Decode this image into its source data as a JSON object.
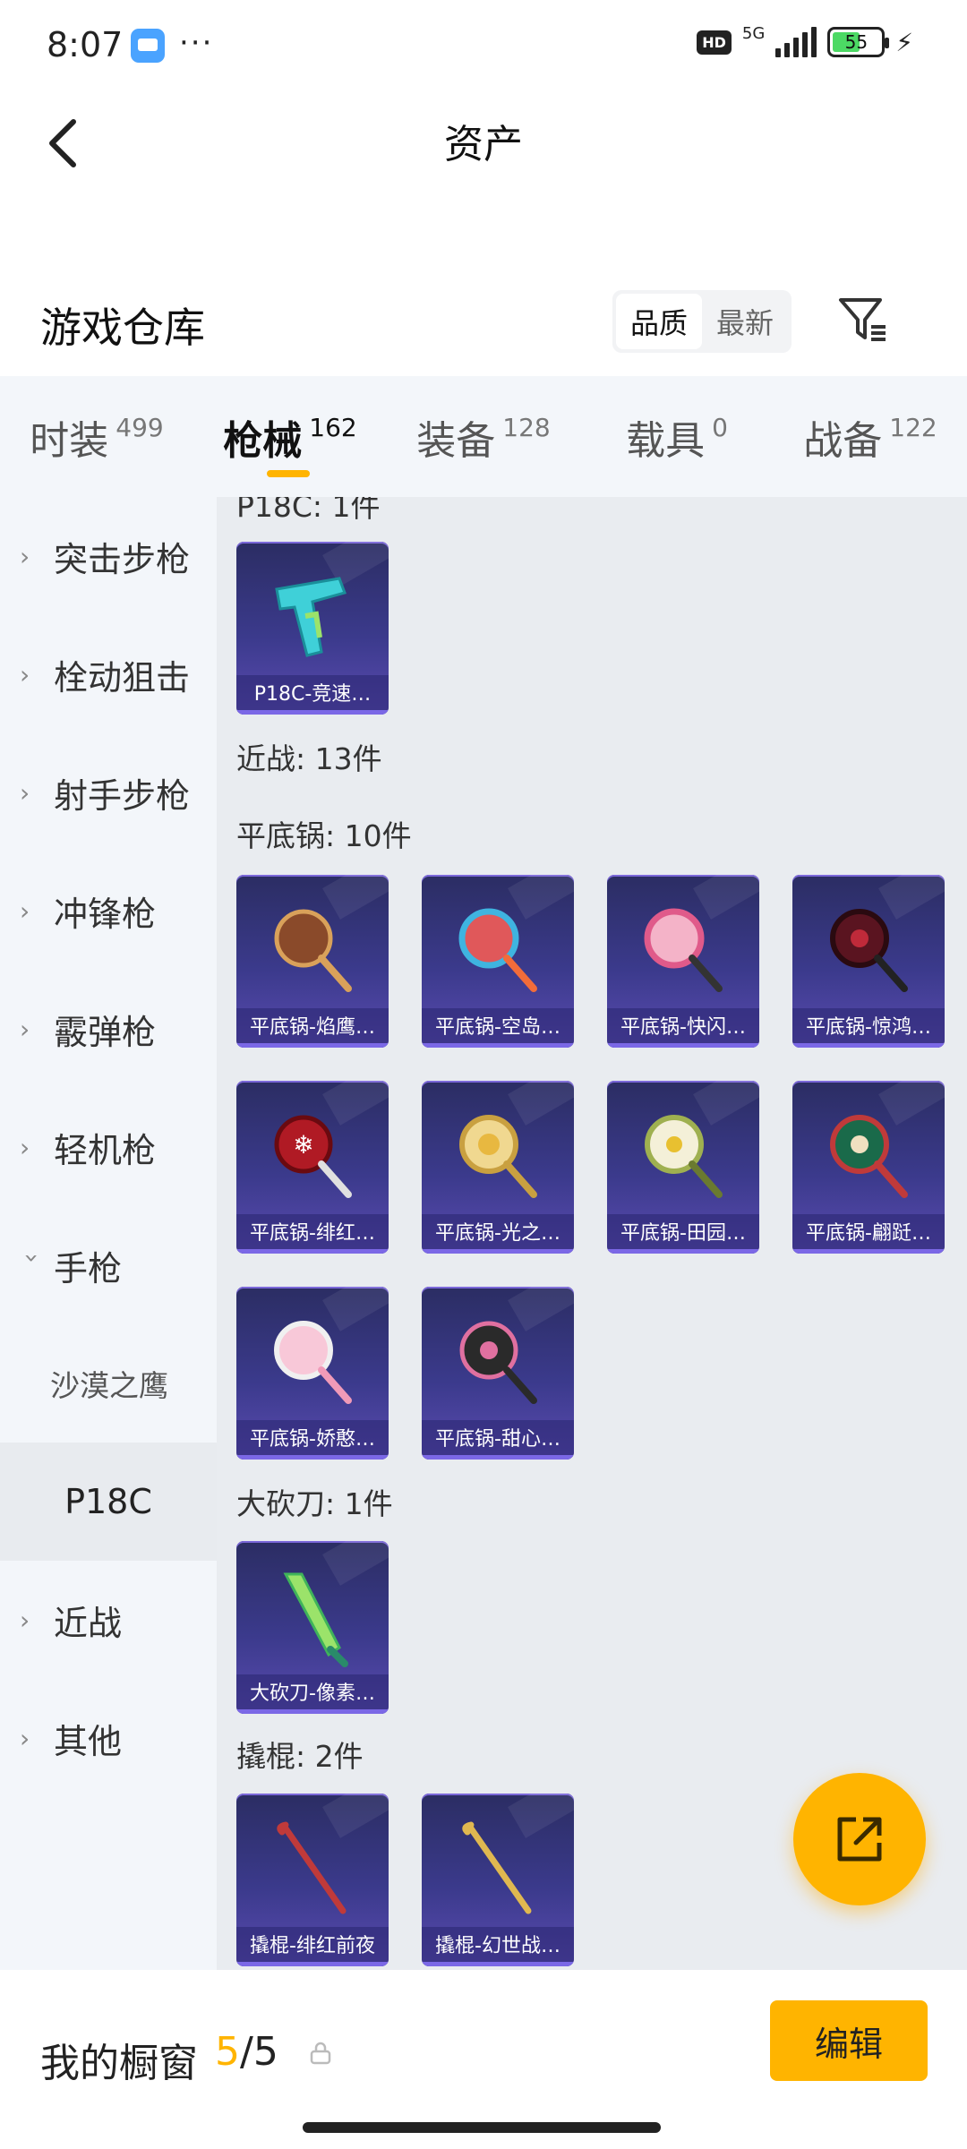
{
  "status_bar": {
    "time": "8:07",
    "dots": "···",
    "hd": "HD",
    "network": "5G",
    "battery": "55"
  },
  "header": {
    "title": "资产"
  },
  "warehouse": {
    "title": "游戏仓库",
    "sort_options": [
      "品质",
      "最新"
    ],
    "active_sort": "品质"
  },
  "tabs": [
    {
      "label": "时装",
      "count": "499"
    },
    {
      "label": "枪械",
      "count": "162"
    },
    {
      "label": "装备",
      "count": "128"
    },
    {
      "label": "载具",
      "count": "0"
    },
    {
      "label": "战备",
      "count": "122"
    }
  ],
  "active_tab": "枪械",
  "sidebar": {
    "items": [
      {
        "label": "突击步枪"
      },
      {
        "label": "栓动狙击"
      },
      {
        "label": "射手步枪"
      },
      {
        "label": "冲锋枪"
      },
      {
        "label": "霰弹枪"
      },
      {
        "label": "轻机枪"
      },
      {
        "label": "手枪"
      },
      {
        "label": "近战"
      },
      {
        "label": "其他"
      }
    ],
    "sub_items": [
      {
        "label": "沙漠之鹰"
      },
      {
        "label": "P18C"
      }
    ],
    "active_sub": "P18C"
  },
  "content": {
    "sections": {
      "p18c": "P18C: 1件",
      "melee": "近战: 13件",
      "pan": "平底锅: 10件",
      "machete": "大砍刀: 1件",
      "crowbar": "撬棍: 2件"
    },
    "p18c_items": [
      {
        "name": "P18C-竞速…"
      }
    ],
    "pan_items": [
      {
        "name": "平底锅-焰鹰…"
      },
      {
        "name": "平底锅-空岛…"
      },
      {
        "name": "平底锅-快闪…"
      },
      {
        "name": "平底锅-惊鸿…"
      },
      {
        "name": "平底锅-绯红…"
      },
      {
        "name": "平底锅-光之…"
      },
      {
        "name": "平底锅-田园…"
      },
      {
        "name": "平底锅-翩跹…"
      },
      {
        "name": "平底锅-娇憨…"
      },
      {
        "name": "平底锅-甜心…"
      }
    ],
    "machete_items": [
      {
        "name": "大砍刀-像素…"
      }
    ],
    "crowbar_items": [
      {
        "name": "撬棍-绯红前夜"
      },
      {
        "name": "撬棍-幻世战…"
      }
    ]
  },
  "bottom": {
    "window_label": "我的橱窗",
    "window_current": "5",
    "window_sep": "/",
    "window_max": "5",
    "edit_label": "编辑"
  },
  "colors": {
    "accent": "#ffb400",
    "card_top": "#2b2d63",
    "card_bottom": "#5a4bb0"
  }
}
